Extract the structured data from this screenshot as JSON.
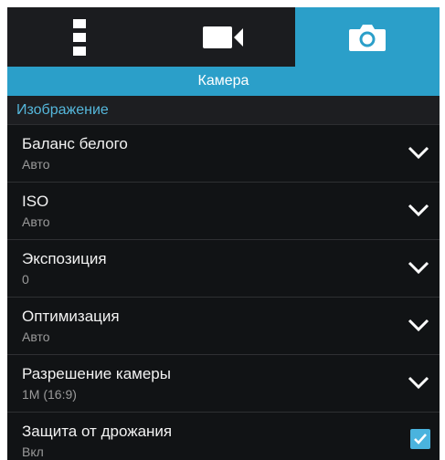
{
  "tabs": [
    {
      "icon": "more-vert-icon",
      "active": false
    },
    {
      "icon": "video-camera-icon",
      "active": false
    },
    {
      "icon": "camera-icon",
      "active": true
    }
  ],
  "header": {
    "title": "Камера"
  },
  "section": {
    "title": "Изображение"
  },
  "settings": [
    {
      "title": "Баланс белого",
      "value": "Авто",
      "control": "dropdown"
    },
    {
      "title": "ISO",
      "value": "Авто",
      "control": "dropdown"
    },
    {
      "title": "Экспозиция",
      "value": "0",
      "control": "dropdown"
    },
    {
      "title": "Оптимизация",
      "value": "Авто",
      "control": "dropdown"
    },
    {
      "title": "Разрешение камеры",
      "value": "1M (16:9)",
      "control": "dropdown"
    },
    {
      "title": "Защита от дрожания",
      "value": "Вкл",
      "control": "checkbox",
      "checked": true
    }
  ],
  "colors": {
    "accent": "#2b9fc9",
    "background": "#111315",
    "section_text": "#55b7db"
  }
}
